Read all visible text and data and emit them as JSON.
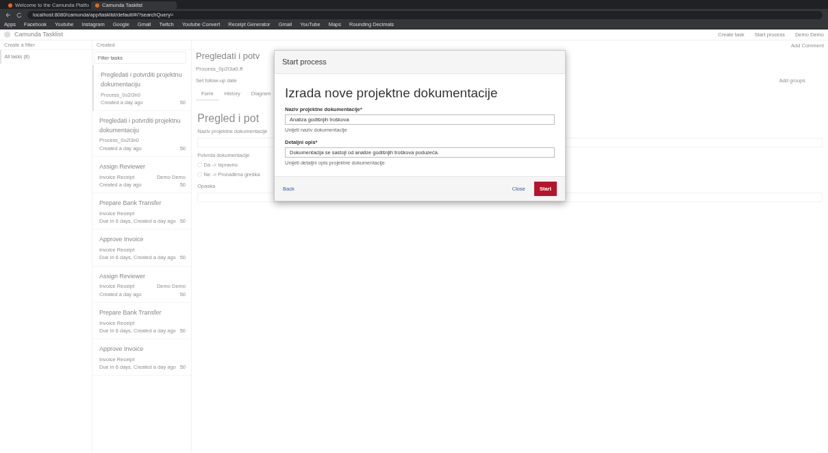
{
  "browser": {
    "tabs": [
      {
        "title": "Welcome to the Camunda Platfo",
        "selected": false
      },
      {
        "title": "Camunda Tasklist",
        "selected": true
      }
    ],
    "address": "localhost:8080/camunda/app/tasklist/default/#/?searchQuery=",
    "bookmarks": [
      "Apps",
      "Facebook",
      "Youtube",
      "Instagram",
      "Google",
      "Gmail",
      "Twitch",
      "Youtube Convert",
      "Receipt Generator",
      "Gmail",
      "YouTube",
      "Maps",
      "Rounding Decimals"
    ]
  },
  "app": {
    "title": "Camunda Tasklist",
    "header_links": [
      "Create task",
      "Start process",
      "Demo Demo"
    ]
  },
  "filters": {
    "create": "Create a filter",
    "items": [
      {
        "label": "All tasks (8)",
        "selected": true
      }
    ]
  },
  "task_list": {
    "sort": "Created",
    "search_placeholder": "Filter tasks",
    "tasks": [
      {
        "name": "Pregledati i potvrditi projektnu dokumentaciju",
        "process": "Process_0o2l3n0",
        "created": "Created a day ago",
        "priority": "50",
        "selected": true
      },
      {
        "name": "Pregledati i potvrditi projektnu dokumentaciju",
        "process": "Process_0o2l3n0",
        "created": "Created a day ago",
        "priority": "50",
        "selected": false
      },
      {
        "name": "Assign Reviewer",
        "process": "Invoice Receipt",
        "assignee": "Demo Demo",
        "created": "Created a day ago",
        "priority": "50",
        "selected": false
      },
      {
        "name": "Prepare Bank Transfer",
        "process": "Invoice Receipt",
        "created": "Due in 6 days, Created a day ago",
        "priority": "50",
        "selected": false
      },
      {
        "name": "Approve Invoice",
        "process": "Invoice Receipt",
        "created": "Due in 6 days, Created a day ago",
        "priority": "50",
        "selected": false
      },
      {
        "name": "Assign Reviewer",
        "process": "Invoice Receipt",
        "assignee": "Demo Demo",
        "created": "Created a day ago",
        "priority": "50",
        "selected": false
      },
      {
        "name": "Prepare Bank Transfer",
        "process": "Invoice Receipt",
        "created": "Due in 6 days, Created a day ago",
        "priority": "50",
        "selected": false
      },
      {
        "name": "Approve Invoice",
        "process": "Invoice Receipt",
        "created": "Due in 6 days, Created a day ago",
        "priority": "50",
        "selected": false
      }
    ]
  },
  "detail": {
    "title": "Pregledati i potv",
    "process": "Process_0p2l3a0.ff",
    "follow_up": "Set follow-up date",
    "groups": "Add groups",
    "comment": "Add Comment",
    "tabs": [
      {
        "label": "Form",
        "selected": true
      },
      {
        "label": "History",
        "selected": false
      },
      {
        "label": "Diagram",
        "selected": false
      }
    ],
    "form_title": "Pregled i pot",
    "field_label": "Naziv projektne dokumentacije",
    "radio_label": "Potvrda dokumentacije",
    "options": [
      {
        "label": "Da -> Ispravno",
        "checked": false
      },
      {
        "label": "Ne -> Pronađena greška",
        "checked": false
      }
    ],
    "note_label": "Opaska"
  },
  "modal": {
    "title": "Start process",
    "heading": "Izrada nove projektne dokumentacije",
    "fields": [
      {
        "label": "Naziv projektne dokumentacije*",
        "value": "Analiza godišnjih troškova",
        "help": "Unijeti naziv dokumentacije"
      },
      {
        "label": "Detaljni opis*",
        "value": "Dokumentacija se sastoji od analize godišnjih troškova poduzeća.",
        "help": "Unijeti detaljni opis projektne dokumentacije"
      }
    ],
    "back": "Back",
    "close": "Close",
    "start": "Start"
  }
}
